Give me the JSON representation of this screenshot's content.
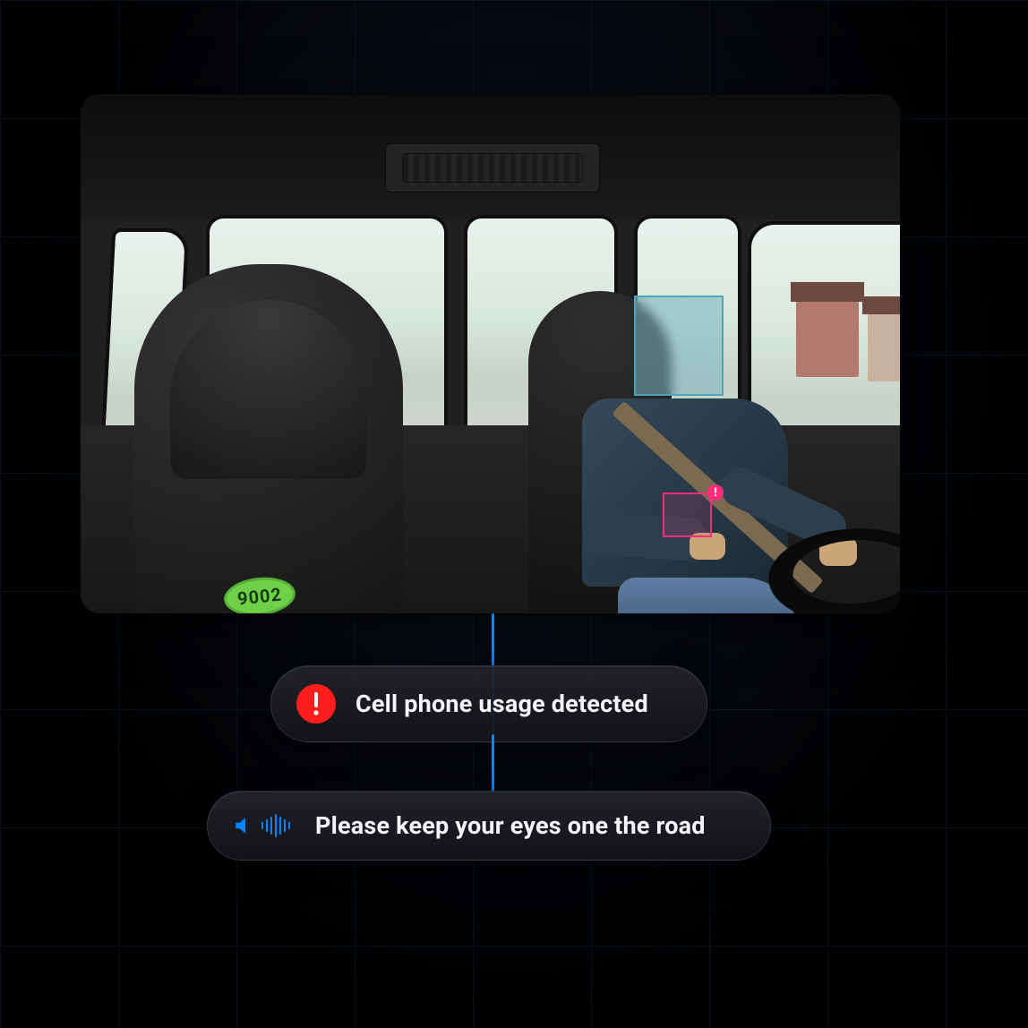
{
  "detections": {
    "face": {
      "label": "face-detection-box"
    },
    "phone": {
      "label": "phone-detection-box",
      "bang": "!"
    }
  },
  "seat_tag": "9002",
  "alerts": [
    {
      "icon": "alert-icon",
      "text": "Cell phone usage detected"
    },
    {
      "icon": "speaker-icon",
      "text": "Please keep your eyes one the road"
    }
  ],
  "colors": {
    "accent_blue": "#0a84ff",
    "alert_red": "#ff1e1e",
    "phone_box": "#ff2d79",
    "face_box": "#4aa7b5"
  }
}
